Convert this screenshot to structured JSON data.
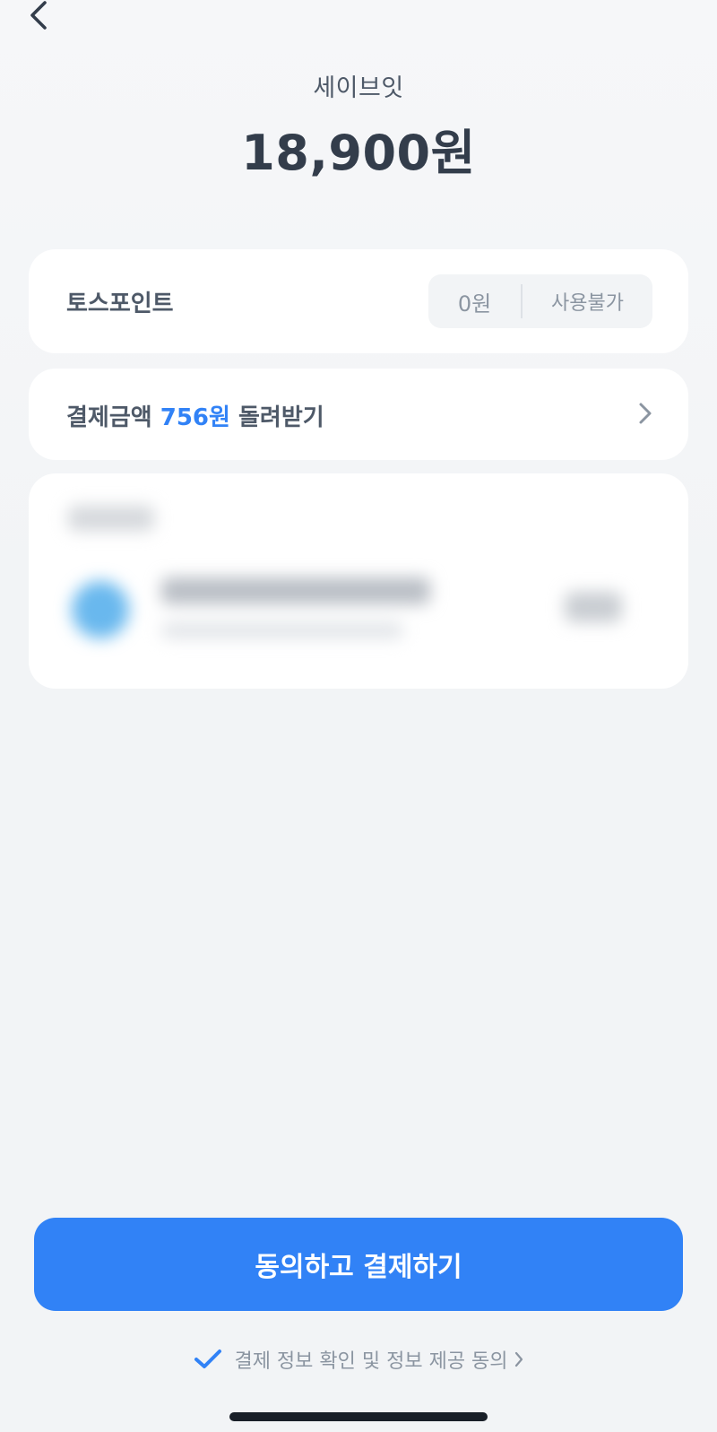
{
  "header": {
    "back_icon": "chevron-left-icon"
  },
  "summary": {
    "merchant": "세이브잇",
    "amount": "18,900원"
  },
  "points": {
    "label": "토스포인트",
    "value": "0원",
    "status": "사용불가"
  },
  "cashback": {
    "prefix": "결제금액 ",
    "amount": "756원",
    "suffix": " 돌려받기",
    "icon": "chevron-right-icon"
  },
  "footer": {
    "pay_button_label": "동의하고 결제하기",
    "agreement_label": "결제 정보 확인 및 정보 제공 동의",
    "check_icon": "check-icon"
  },
  "colors": {
    "accent": "#3182f6",
    "background": "#f2f4f6",
    "card": "#ffffff",
    "text_primary": "#333d4b",
    "text_secondary": "#8b95a1"
  }
}
